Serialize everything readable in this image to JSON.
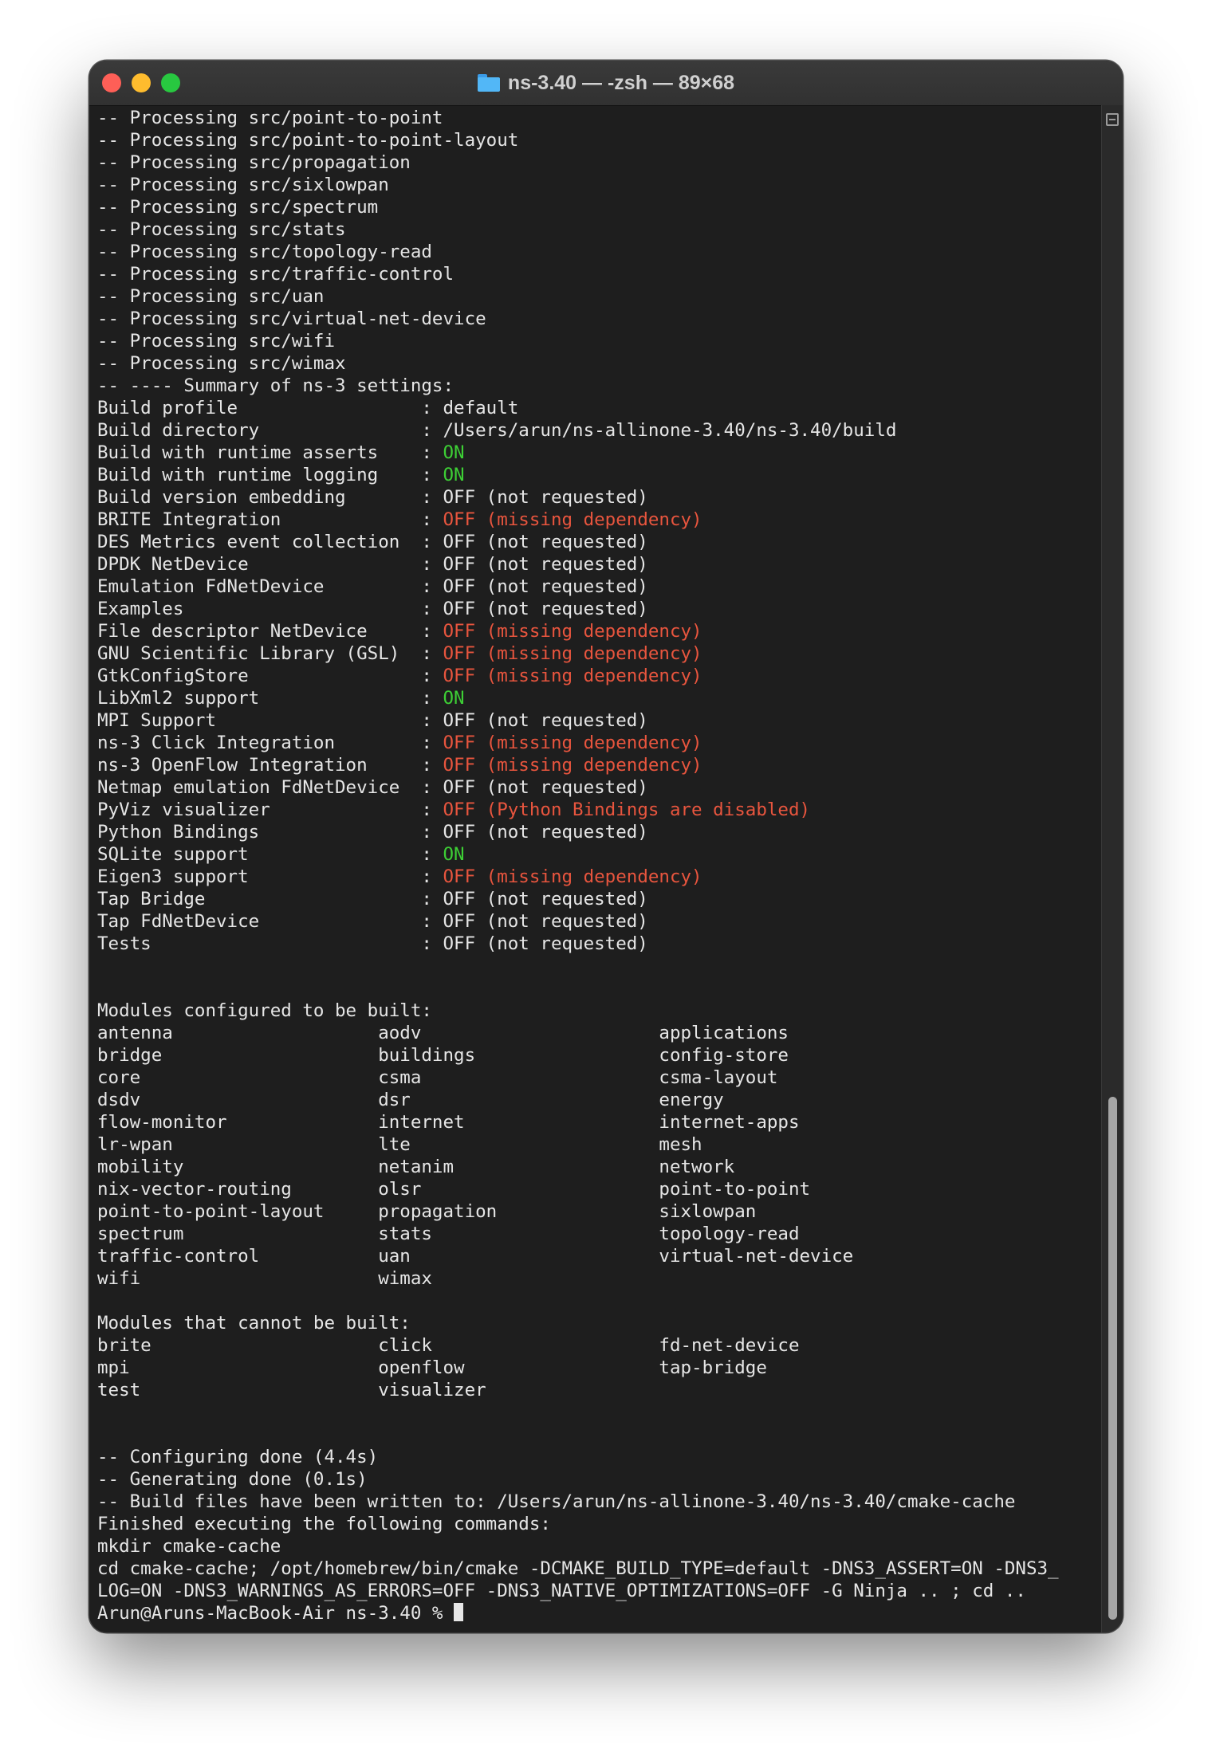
{
  "window": {
    "title": "ns-3.40 — -zsh — 89×68"
  },
  "terminal": {
    "lines": [
      [
        {
          "t": "-- Processing src/point-to-point"
        }
      ],
      [
        {
          "t": "-- Processing src/point-to-point-layout"
        }
      ],
      [
        {
          "t": "-- Processing src/propagation"
        }
      ],
      [
        {
          "t": "-- Processing src/sixlowpan"
        }
      ],
      [
        {
          "t": "-- Processing src/spectrum"
        }
      ],
      [
        {
          "t": "-- Processing src/stats"
        }
      ],
      [
        {
          "t": "-- Processing src/topology-read"
        }
      ],
      [
        {
          "t": "-- Processing src/traffic-control"
        }
      ],
      [
        {
          "t": "-- Processing src/uan"
        }
      ],
      [
        {
          "t": "-- Processing src/virtual-net-device"
        }
      ],
      [
        {
          "t": "-- Processing src/wifi"
        }
      ],
      [
        {
          "t": "-- Processing src/wimax"
        }
      ],
      [
        {
          "t": "-- ---- Summary of ns-3 settings:"
        }
      ],
      [
        {
          "t": "Build profile                 : default"
        }
      ],
      [
        {
          "t": "Build directory               : /Users/arun/ns-allinone-3.40/ns-3.40/build"
        }
      ],
      [
        {
          "t": "Build with runtime asserts    : "
        },
        {
          "t": "ON",
          "c": "green"
        }
      ],
      [
        {
          "t": "Build with runtime logging    : "
        },
        {
          "t": "ON",
          "c": "green"
        }
      ],
      [
        {
          "t": "Build version embedding       : OFF (not requested)"
        }
      ],
      [
        {
          "t": "BRITE Integration             : "
        },
        {
          "t": "OFF (missing dependency)",
          "c": "red"
        }
      ],
      [
        {
          "t": "DES Metrics event collection  : OFF (not requested)"
        }
      ],
      [
        {
          "t": "DPDK NetDevice                : OFF (not requested)"
        }
      ],
      [
        {
          "t": "Emulation FdNetDevice         : OFF (not requested)"
        }
      ],
      [
        {
          "t": "Examples                      : OFF (not requested)"
        }
      ],
      [
        {
          "t": "File descriptor NetDevice     : "
        },
        {
          "t": "OFF (missing dependency)",
          "c": "red"
        }
      ],
      [
        {
          "t": "GNU Scientific Library (GSL)  : "
        },
        {
          "t": "OFF (missing dependency)",
          "c": "red"
        }
      ],
      [
        {
          "t": "GtkConfigStore                : "
        },
        {
          "t": "OFF (missing dependency)",
          "c": "red"
        }
      ],
      [
        {
          "t": "LibXml2 support               : "
        },
        {
          "t": "ON",
          "c": "green"
        }
      ],
      [
        {
          "t": "MPI Support                   : OFF (not requested)"
        }
      ],
      [
        {
          "t": "ns-3 Click Integration        : "
        },
        {
          "t": "OFF (missing dependency)",
          "c": "red"
        }
      ],
      [
        {
          "t": "ns-3 OpenFlow Integration     : "
        },
        {
          "t": "OFF (missing dependency)",
          "c": "red"
        }
      ],
      [
        {
          "t": "Netmap emulation FdNetDevice  : OFF (not requested)"
        }
      ],
      [
        {
          "t": "PyViz visualizer              : "
        },
        {
          "t": "OFF (Python Bindings are disabled)",
          "c": "red"
        }
      ],
      [
        {
          "t": "Python Bindings               : OFF (not requested)"
        }
      ],
      [
        {
          "t": "SQLite support                : "
        },
        {
          "t": "ON",
          "c": "green"
        }
      ],
      [
        {
          "t": "Eigen3 support                : "
        },
        {
          "t": "OFF (missing dependency)",
          "c": "red"
        }
      ],
      [
        {
          "t": "Tap Bridge                    : OFF (not requested)"
        }
      ],
      [
        {
          "t": "Tap FdNetDevice               : OFF (not requested)"
        }
      ],
      [
        {
          "t": "Tests                         : OFF (not requested)"
        }
      ],
      [
        {
          "t": ""
        }
      ],
      [
        {
          "t": ""
        }
      ],
      [
        {
          "t": "Modules configured to be built:"
        }
      ],
      [
        {
          "t": "antenna                   aodv                      applications"
        }
      ],
      [
        {
          "t": "bridge                    buildings                 config-store"
        }
      ],
      [
        {
          "t": "core                      csma                      csma-layout"
        }
      ],
      [
        {
          "t": "dsdv                      dsr                       energy"
        }
      ],
      [
        {
          "t": "flow-monitor              internet                  internet-apps"
        }
      ],
      [
        {
          "t": "lr-wpan                   lte                       mesh"
        }
      ],
      [
        {
          "t": "mobility                  netanim                   network"
        }
      ],
      [
        {
          "t": "nix-vector-routing        olsr                      point-to-point"
        }
      ],
      [
        {
          "t": "point-to-point-layout     propagation               sixlowpan"
        }
      ],
      [
        {
          "t": "spectrum                  stats                     topology-read"
        }
      ],
      [
        {
          "t": "traffic-control           uan                       virtual-net-device"
        }
      ],
      [
        {
          "t": "wifi                      wimax"
        }
      ],
      [
        {
          "t": ""
        }
      ],
      [
        {
          "t": "Modules that cannot be built:"
        }
      ],
      [
        {
          "t": "brite                     click                     fd-net-device"
        }
      ],
      [
        {
          "t": "mpi                       openflow                  tap-bridge"
        }
      ],
      [
        {
          "t": "test                      visualizer"
        }
      ],
      [
        {
          "t": ""
        }
      ],
      [
        {
          "t": ""
        }
      ],
      [
        {
          "t": "-- Configuring done (4.4s)"
        }
      ],
      [
        {
          "t": "-- Generating done (0.1s)"
        }
      ],
      [
        {
          "t": "-- Build files have been written to: /Users/arun/ns-allinone-3.40/ns-3.40/cmake-cache"
        }
      ],
      [
        {
          "t": "Finished executing the following commands:"
        }
      ],
      [
        {
          "t": "mkdir cmake-cache"
        }
      ],
      [
        {
          "t": "cd cmake-cache; /opt/homebrew/bin/cmake -DCMAKE_BUILD_TYPE=default -DNS3_ASSERT=ON -DNS3_"
        }
      ],
      [
        {
          "t": "LOG=ON -DNS3_WARNINGS_AS_ERRORS=OFF -DNS3_NATIVE_OPTIMIZATIONS=OFF -G Ninja .. ; cd .."
        }
      ]
    ],
    "prompt": "Arun@Aruns-MacBook-Air ns-3.40 % "
  }
}
